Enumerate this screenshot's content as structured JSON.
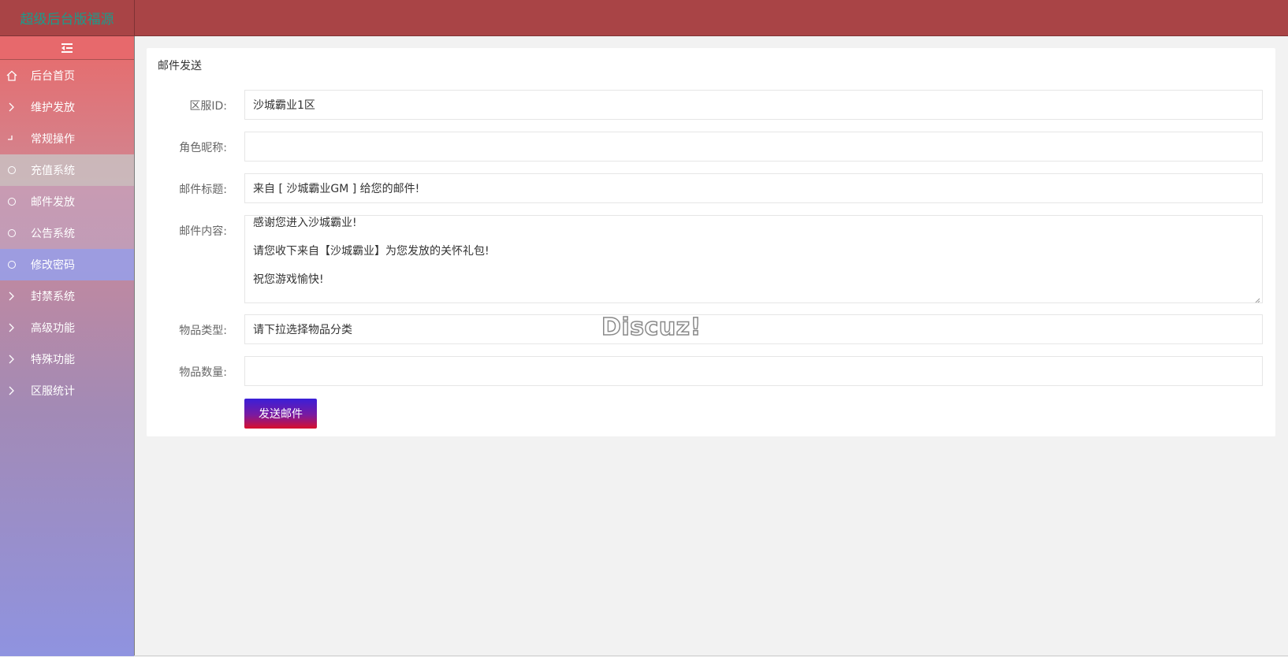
{
  "header": {
    "logo_text": "超级后台版福源"
  },
  "sidebar": {
    "toggle_icon": "indent-icon",
    "items": [
      {
        "label": "后台首页",
        "icon": "home-icon"
      },
      {
        "label": "维护发放",
        "icon": "chevron-right-icon"
      },
      {
        "label": "常规操作",
        "icon": "chevron-down-icon"
      },
      {
        "label": "充值系统",
        "icon": "circle-icon"
      },
      {
        "label": "邮件发放",
        "icon": "circle-icon"
      },
      {
        "label": "公告系统",
        "icon": "circle-icon"
      },
      {
        "label": "修改密码",
        "icon": "circle-icon"
      },
      {
        "label": "封禁系统",
        "icon": "chevron-right-icon"
      },
      {
        "label": "高级功能",
        "icon": "chevron-right-icon"
      },
      {
        "label": "特殊功能",
        "icon": "chevron-right-icon"
      },
      {
        "label": "区服统计",
        "icon": "chevron-right-icon"
      }
    ]
  },
  "main": {
    "card_title": "邮件发送",
    "form": {
      "server_id": {
        "label": "区服ID:",
        "value": "沙城霸业1区"
      },
      "nickname": {
        "label": "角色昵称:",
        "value": ""
      },
      "mail_title": {
        "label": "邮件标题:",
        "value": "来自 [ 沙城霸业GM ] 给您的邮件!"
      },
      "mail_content": {
        "label": "邮件内容:",
        "lines": [
          "感谢您进入沙城霸业!",
          "请您收下来自【沙城霸业】为您发放的关怀礼包!",
          "祝您游戏愉快!"
        ]
      },
      "item_type": {
        "label": "物品类型:",
        "value": "请下拉选择物品分类"
      },
      "item_count": {
        "label": "物品数量:",
        "value": ""
      }
    },
    "send_button": "发送邮件"
  },
  "watermark": "Discuz!"
}
